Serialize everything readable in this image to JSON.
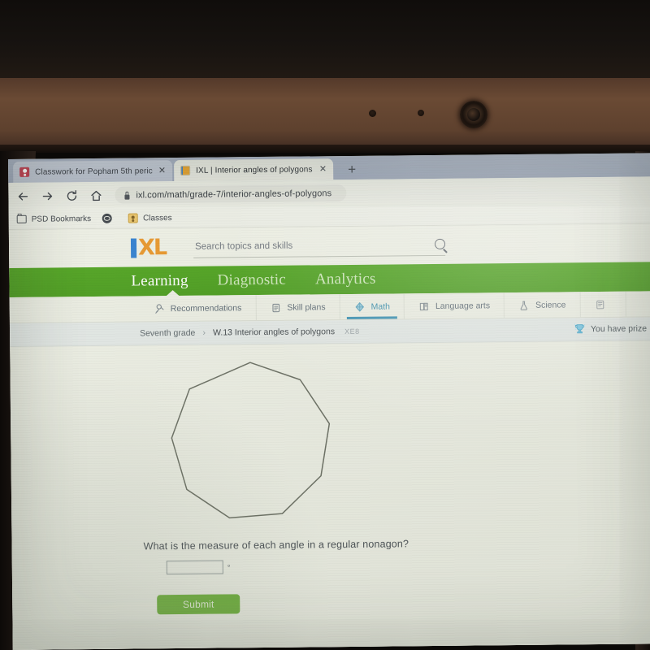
{
  "browser": {
    "tabs": [
      {
        "title": "Classwork for Popham 5th peric",
        "favicon": "google-classroom-icon",
        "active": false,
        "close_label": "✕"
      },
      {
        "title": "IXL | Interior angles of polygons",
        "favicon": "ixl-icon",
        "active": true,
        "close_label": "✕"
      }
    ],
    "new_tab_label": "+",
    "nav": {
      "back_label": "←",
      "forward_label": "→",
      "reload_label": "⟳",
      "home_label": "⌂"
    },
    "omnibox": {
      "url": "ixl.com/math/grade-7/interior-angles-of-polygons",
      "secure_icon": "lock-icon"
    },
    "bookmarks": [
      {
        "label": "PSD Bookmarks",
        "icon": "folder-icon"
      },
      {
        "label": "",
        "icon": "globe-icon"
      },
      {
        "label": "Classes",
        "icon": "classes-icon"
      }
    ]
  },
  "ixl": {
    "logo_text": "XL",
    "search": {
      "placeholder": "Search topics and skills",
      "value": "",
      "icon": "search-icon"
    },
    "primary_nav": [
      {
        "label": "Learning",
        "active": true
      },
      {
        "label": "Diagnostic",
        "active": false
      },
      {
        "label": "Analytics",
        "active": false
      }
    ],
    "subject_tabs": [
      {
        "label": "Recommendations",
        "icon": "recommendations-icon",
        "active": false
      },
      {
        "label": "Skill plans",
        "icon": "skill-plans-icon",
        "active": false
      },
      {
        "label": "Math",
        "icon": "math-icon",
        "active": true
      },
      {
        "label": "Language arts",
        "icon": "language-arts-icon",
        "active": false
      },
      {
        "label": "Science",
        "icon": "science-icon",
        "active": false
      },
      {
        "label": "",
        "icon": "social-studies-icon",
        "active": false
      }
    ],
    "breadcrumb": {
      "grade": "Seventh grade",
      "separator": "›",
      "skill": "W.13 Interior angles of polygons",
      "skill_code": "XE8"
    },
    "prizes": {
      "label": "You have prize",
      "icon": "trophy-icon"
    }
  },
  "question": {
    "figure": "regular-nonagon",
    "sides": 9,
    "prompt": "What is the measure of each angle in a regular nonagon?",
    "answer_value": "",
    "unit_symbol": "°",
    "submit_label": "Submit"
  },
  "colors": {
    "ixl_green": "#4fa31e",
    "ixl_orange": "#e9962a",
    "ixl_blue": "#2f7fd0",
    "math_teal": "#3e93b4",
    "submit_green": "#72b33f"
  }
}
